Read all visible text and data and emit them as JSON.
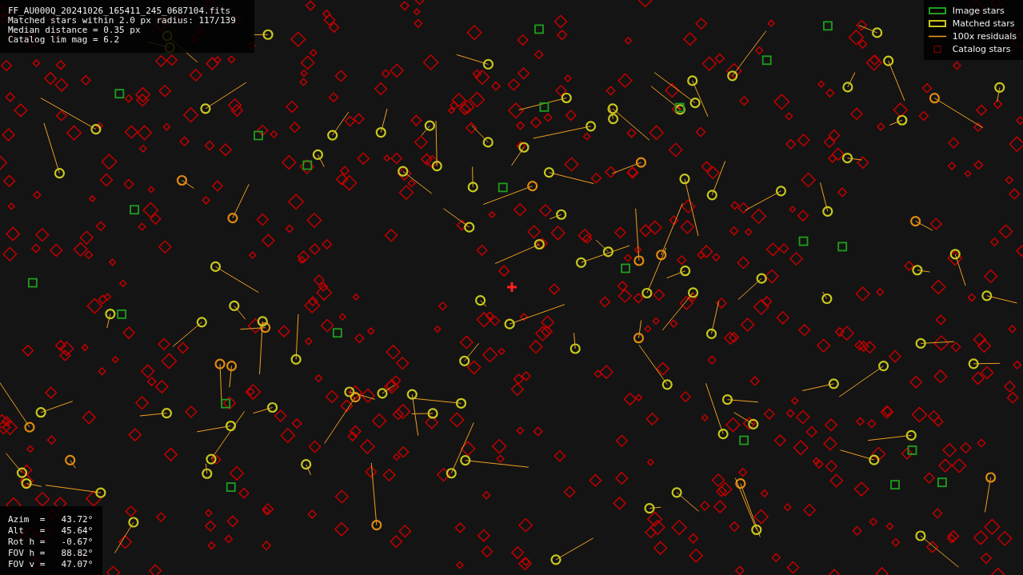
{
  "info": {
    "lines": [
      "FF_AU000Q_20241026_165411_245_0687104.fits",
      "Matched stars within 2.0 px radius: 117/139",
      "Median distance = 0.35 px",
      "Catalog lim mag = 6.2"
    ]
  },
  "legend": [
    {
      "kind": "image",
      "label": "Image stars",
      "color": "#1f9e1f"
    },
    {
      "kind": "matched",
      "label": "Matched stars",
      "color": "#c8c81e"
    },
    {
      "kind": "residual",
      "label": "100x residuals",
      "color": "#f0a020"
    },
    {
      "kind": "catalog",
      "label": "Catalog stars",
      "color": "#8a0000"
    }
  ],
  "pointing": [
    {
      "label": "Azim  =",
      "value": "43.72°"
    },
    {
      "label": "Alt   =",
      "value": "45.64°"
    },
    {
      "label": "Rot h =",
      "value": "-0.67°"
    },
    {
      "label": "FOV h =",
      "value": "88.82°"
    },
    {
      "label": "FOV v =",
      "value": "47.07°"
    }
  ]
}
